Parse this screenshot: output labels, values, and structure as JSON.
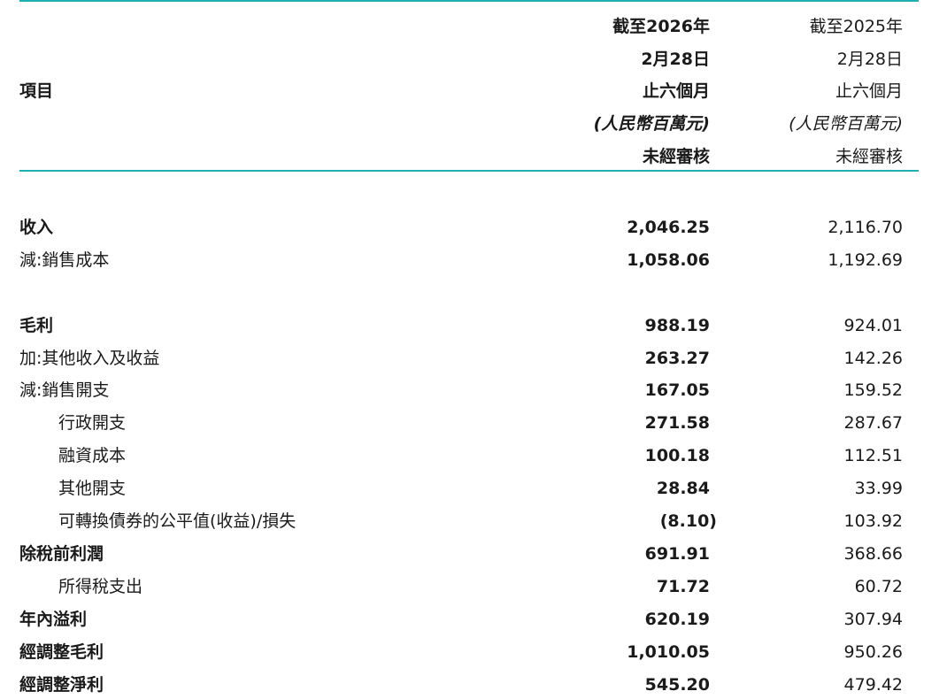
{
  "header": {
    "item_label": "項目",
    "col1": {
      "line1": "截至2026年",
      "line2": "2月28日",
      "line3": "止六個月",
      "line4": "(人民幣百萬元)",
      "line5": "未經審核"
    },
    "col2": {
      "line1": "截至2025年",
      "line2": "2月28日",
      "line3": "止六個月",
      "line4": "(人民幣百萬元)",
      "line5": "未經審核"
    }
  },
  "rows": [
    {
      "label": "收入",
      "v2026": "2,046.25",
      "v2025": "2,116.70"
    },
    {
      "label": "減:銷售成本",
      "v2026": "1,058.06",
      "v2025": "1,192.69"
    },
    {
      "label": "毛利",
      "v2026": "988.19",
      "v2025": "924.01"
    },
    {
      "label": "加:其他收入及收益",
      "v2026": "263.27",
      "v2025": "142.26"
    },
    {
      "label": "減:銷售開支",
      "v2026": "167.05",
      "v2025": "159.52"
    },
    {
      "label": "行政開支",
      "v2026": "271.58",
      "v2025": "287.67"
    },
    {
      "label": "融資成本",
      "v2026": "100.18",
      "v2025": "112.51"
    },
    {
      "label": "其他開支",
      "v2026": "28.84",
      "v2025": "33.99"
    },
    {
      "label": "可轉換債券的公平值(收益)/損失",
      "v2026": "(8.10)",
      "v2025": "103.92"
    },
    {
      "label": "除稅前利潤",
      "v2026": "691.91",
      "v2025": "368.66"
    },
    {
      "label": "所得稅支出",
      "v2026": "71.72",
      "v2025": "60.72"
    },
    {
      "label": "年內溢利",
      "v2026": "620.19",
      "v2025": "307.94"
    },
    {
      "label": "經調整毛利",
      "v2026": "1,010.05",
      "v2025": "950.26"
    },
    {
      "label": "經調整淨利",
      "v2026": "545.20",
      "v2025": "479.42"
    }
  ]
}
